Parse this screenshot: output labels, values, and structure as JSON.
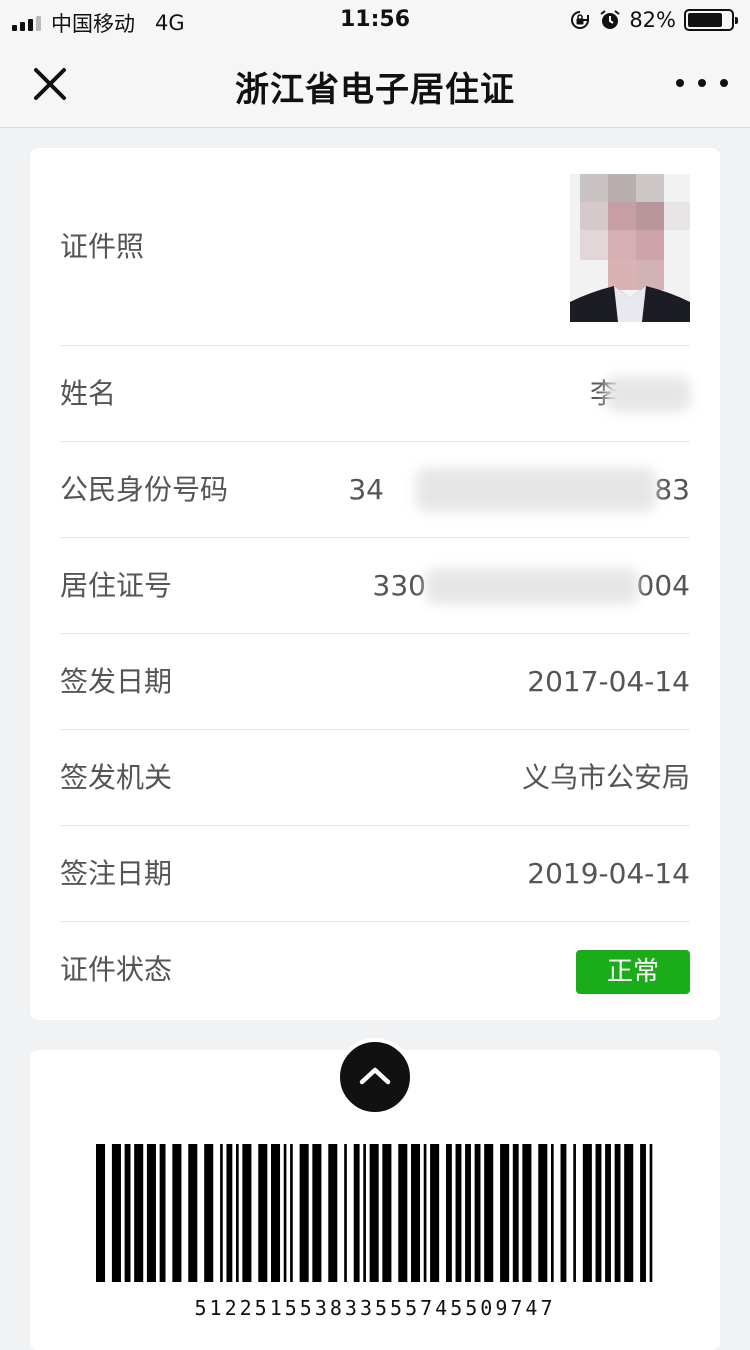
{
  "status_bar": {
    "carrier": "中国移动",
    "network": "4G",
    "time": "11:56",
    "battery_percent": "82%",
    "battery_level": 0.82,
    "icons": [
      "signal-icon",
      "orientation-lock-icon",
      "alarm-icon",
      "battery-icon"
    ]
  },
  "nav": {
    "title": "浙江省电子居住证",
    "close_icon": "close-icon",
    "more_icon": "more-icon"
  },
  "info": {
    "photo_label": "证件照",
    "name_label": "姓名",
    "name_value": "李",
    "id_label": "公民身份号码",
    "id_prefix": "34",
    "id_suffix": "83",
    "permit_label": "居住证号",
    "permit_prefix": "330",
    "permit_suffix": "004",
    "issue_date_label": "签发日期",
    "issue_date_value": "2017-04-14",
    "authority_label": "签发机关",
    "authority_value": "义乌市公安局",
    "endorse_date_label": "签注日期",
    "endorse_date_value": "2019-04-14",
    "status_label": "证件状态",
    "status_value": "正常",
    "status_color": "#1aad19"
  },
  "barcode": {
    "number": "51225155383355574550974​7",
    "toggle_icon": "chevron-up-icon"
  }
}
